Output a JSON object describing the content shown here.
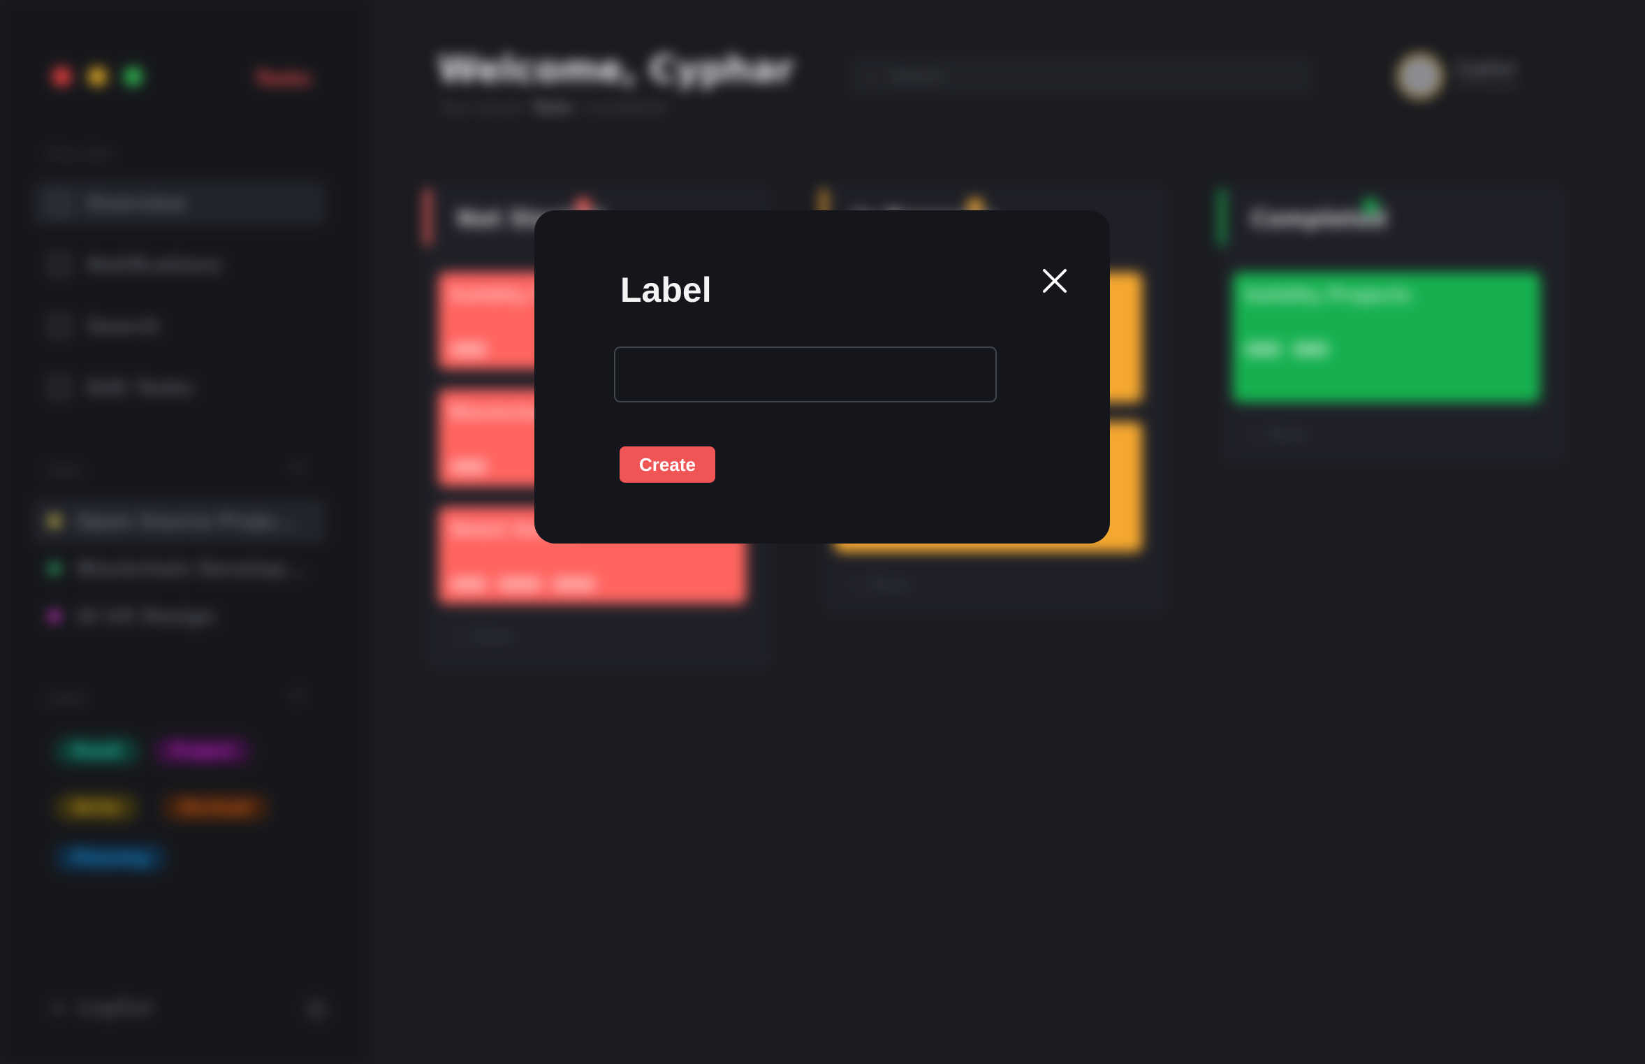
{
  "modal": {
    "title": "Label",
    "input_value": "",
    "input_placeholder": "",
    "create_label": "Create",
    "close_icon": "close-icon",
    "accent": "#f05555"
  },
  "background": {
    "brand": "Tasks",
    "welcome": "Welcome, Cyphar",
    "breadcrumb": [
      "Your board",
      "Tasks",
      "Completed"
    ],
    "search_placeholder": "Search",
    "user": {
      "name": "Cyphar",
      "role": "Developer"
    },
    "sections": {
      "menu": "Overview",
      "projects": "Tasks",
      "labels": "Label"
    },
    "nav": [
      "Overview",
      "Notifications",
      "Search",
      "Edit Tasks"
    ],
    "projects": [
      "Open Source Proje...",
      "Blockchain Develop...",
      "UI UX Design"
    ],
    "labels": [
      "Readi",
      "Project",
      "Write",
      "Devload",
      "Planning"
    ],
    "columns": [
      {
        "title": "Not Started",
        "color": "#ff6460",
        "cards": [
          "Solidity Pr...",
          "Blockchain...",
          "Web3 Dev..."
        ]
      },
      {
        "title": "In Progress",
        "color": "#f5a82f",
        "cards": [
          "",
          ""
        ]
      },
      {
        "title": "Completed",
        "color": "#16b04f",
        "cards": [
          "Solidity Projects"
        ]
      }
    ],
    "add_new": "New",
    "logout": "LogOut"
  }
}
